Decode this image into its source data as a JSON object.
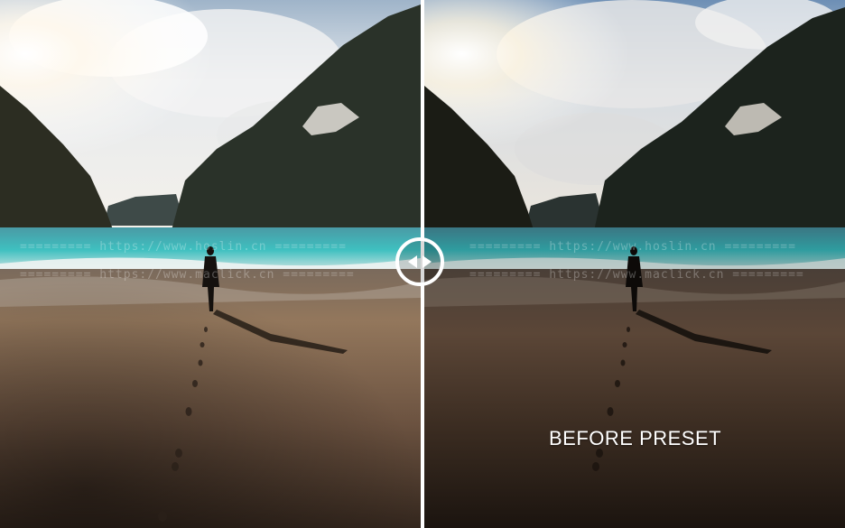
{
  "comparison": {
    "after_image_alt": "Beach scene after preset",
    "before_image_alt": "Beach scene before preset",
    "before_label": "BEFORE PRESET"
  },
  "watermarks": {
    "line_1": "========= https://www.hoslin.cn =========",
    "line_2": "========= https://www.maclick.cn ========="
  },
  "colors": {
    "divider": "#ffffff",
    "handle": "#ffffff",
    "label": "#ffffff"
  },
  "icons": {
    "handle_left": "triangle-left",
    "handle_right": "triangle-right"
  }
}
